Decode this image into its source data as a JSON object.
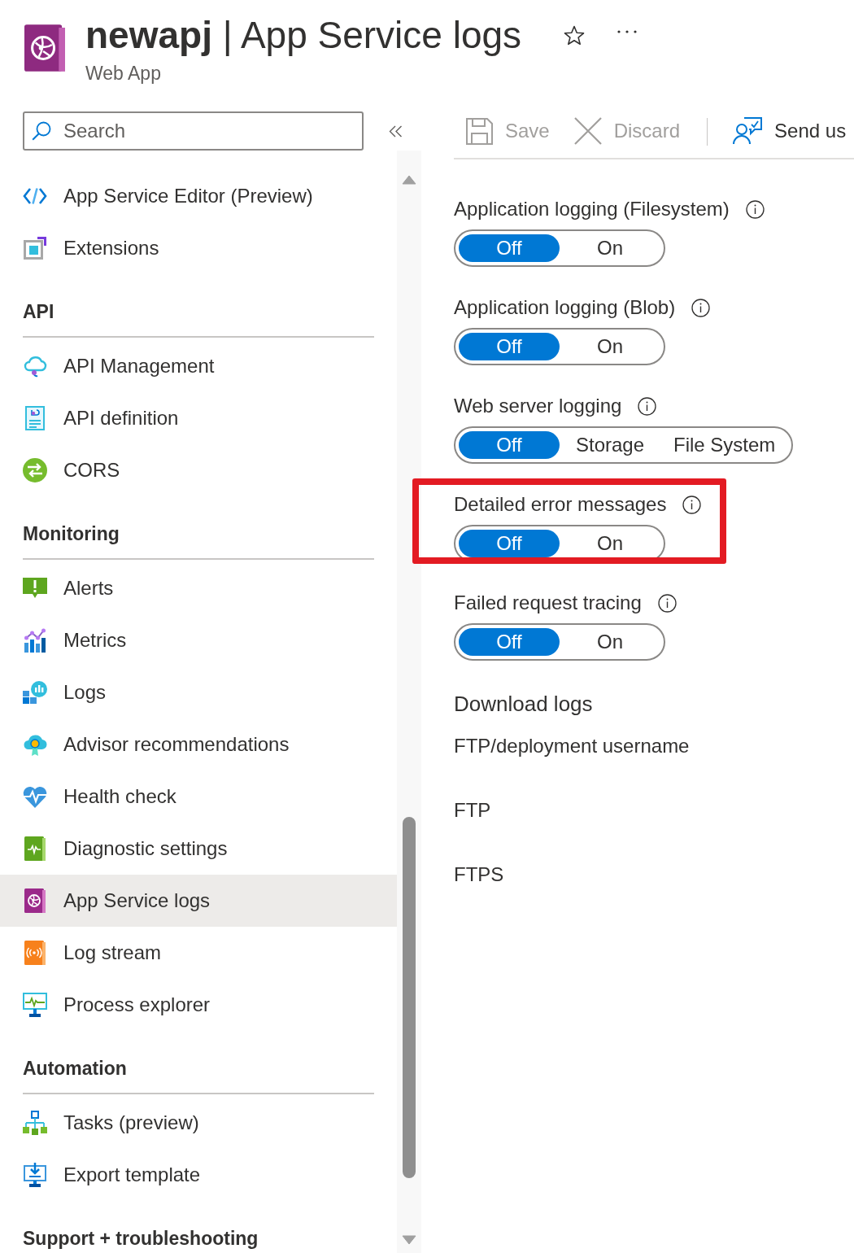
{
  "header": {
    "title": "**newapj** | App Service logs",
    "subtitle": "Web App"
  },
  "sidebar": {
    "search": {
      "placeholder": "Search"
    },
    "groups": [
      {
        "items": [
          {
            "label": "App Service Editor (Preview)",
            "selected": false
          },
          {
            "label": "Extensions",
            "selected": false
          }
        ]
      },
      {
        "heading": "API",
        "items": [
          {
            "label": "API Management",
            "selected": false
          },
          {
            "label": "API definition",
            "selected": false
          },
          {
            "label": "CORS",
            "selected": false
          }
        ]
      },
      {
        "heading": "Monitoring",
        "items": [
          {
            "label": "Alerts",
            "selected": false
          },
          {
            "label": "Metrics",
            "selected": false
          },
          {
            "label": "Logs",
            "selected": false
          },
          {
            "label": "Advisor recommendations",
            "selected": false
          },
          {
            "label": "Health check",
            "selected": false
          },
          {
            "label": "Diagnostic settings",
            "selected": false
          },
          {
            "label": "App Service logs",
            "selected": true
          },
          {
            "label": "Log stream",
            "selected": false
          },
          {
            "label": "Process explorer",
            "selected": false
          }
        ]
      },
      {
        "heading": "Automation",
        "items": [
          {
            "label": "Tasks (preview)",
            "selected": false
          },
          {
            "label": "Export template",
            "selected": false
          }
        ]
      },
      {
        "heading": "Support + troubleshooting"
      }
    ]
  },
  "toolbar": [
    {
      "label": "Save",
      "disabled": true
    },
    {
      "label": "Discard",
      "disabled": true
    },
    {
      "label": "Send us",
      "disabled": false
    }
  ],
  "settings": [
    {
      "label": "Application logging (Filesystem)",
      "highlighted": false,
      "options": [
        {
          "label": "Off",
          "selected": true
        },
        {
          "label": "On",
          "selected": false
        }
      ]
    },
    {
      "label": "Application logging (Blob)",
      "highlighted": false,
      "options": [
        {
          "label": "Off",
          "selected": true
        },
        {
          "label": "On",
          "selected": false
        }
      ]
    },
    {
      "label": "Web server logging",
      "highlighted": false,
      "options": [
        {
          "label": "Off",
          "selected": true
        },
        {
          "label": "Storage",
          "selected": false
        },
        {
          "label": "File System",
          "selected": false
        }
      ]
    },
    {
      "label": "Detailed error messages",
      "highlighted": true,
      "options": [
        {
          "label": "Off",
          "selected": true
        },
        {
          "label": "On",
          "selected": false
        }
      ]
    },
    {
      "label": "Failed request tracing",
      "highlighted": false,
      "options": [
        {
          "label": "Off",
          "selected": true
        },
        {
          "label": "On",
          "selected": false
        }
      ]
    }
  ],
  "download_logs": {
    "heading": "Download logs",
    "fields": [
      "FTP/deployment username",
      "FTP",
      "FTPS"
    ]
  }
}
